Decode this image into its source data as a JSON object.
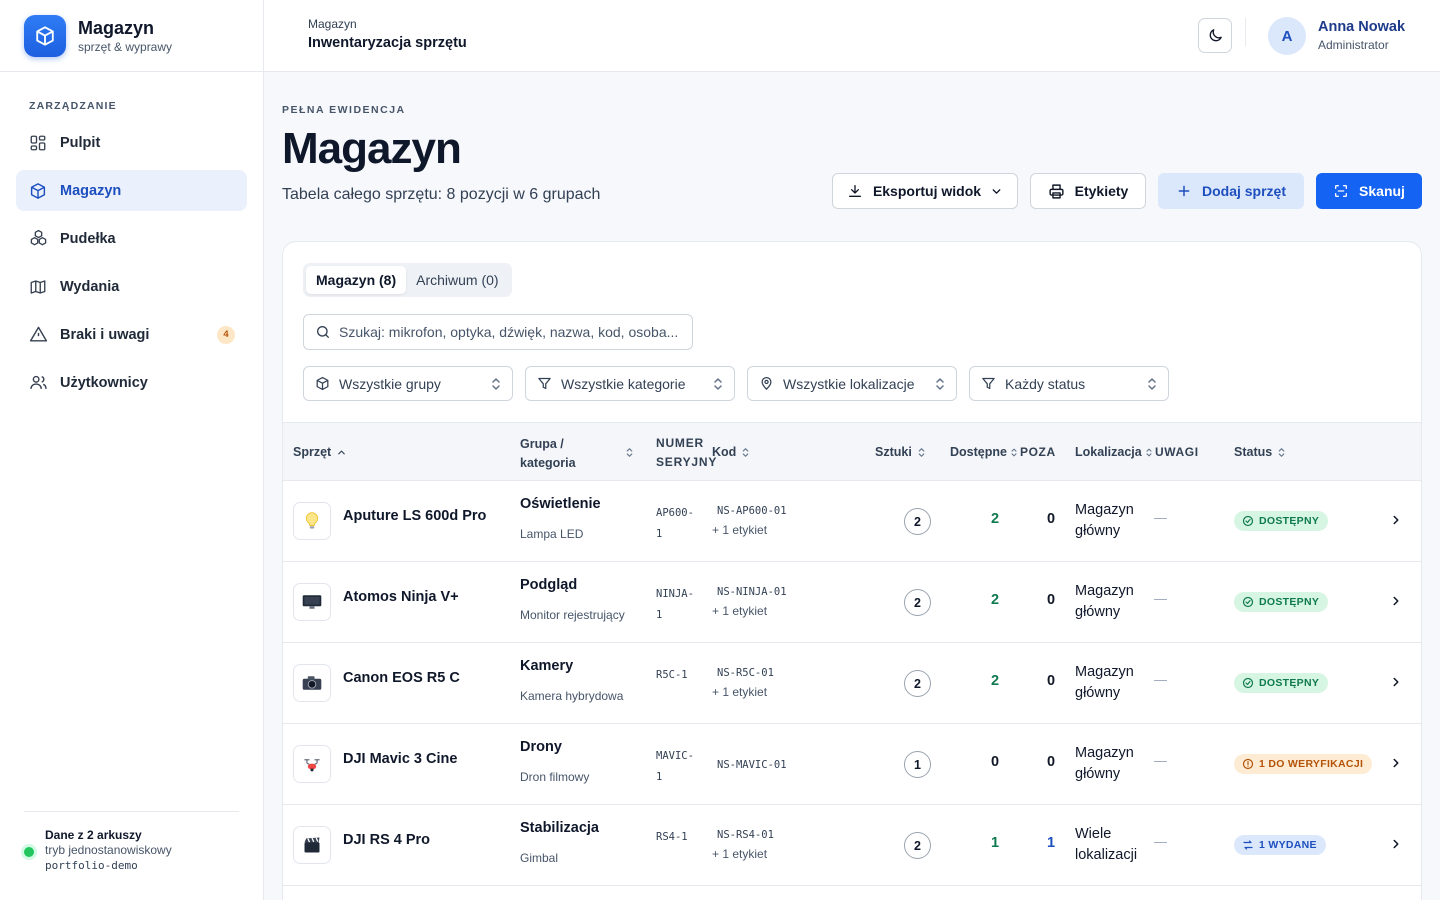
{
  "brand": {
    "title": "Magazyn",
    "subtitle": "sprzęt & wyprawy"
  },
  "sidebar": {
    "section_label": "ZARZĄDZANIE",
    "items": [
      {
        "label": "Pulpit",
        "icon": "dashboard-icon"
      },
      {
        "label": "Magazyn",
        "icon": "box-icon",
        "active": true
      },
      {
        "label": "Pudełka",
        "icon": "boxes-icon"
      },
      {
        "label": "Wydania",
        "icon": "map-icon"
      },
      {
        "label": "Braki i uwagi",
        "icon": "warning-icon",
        "badge": "4"
      },
      {
        "label": "Użytkownicy",
        "icon": "users-icon"
      }
    ],
    "footer": {
      "title": "Dane z 2 arkuszy",
      "subtitle": "tryb jednostanowiskowy",
      "workspace": "portfolio-demo"
    }
  },
  "topbar": {
    "breadcrumb_parent": "Magazyn",
    "breadcrumb_current": "Inwentaryzacja sprzętu",
    "user": {
      "initial": "A",
      "name": "Anna Nowak",
      "role": "Administrator"
    }
  },
  "header": {
    "eyebrow": "PEŁNA EWIDENCJA",
    "title": "Magazyn",
    "subtitle": "Tabela całego sprzętu: 8 pozycji w 6 grupach",
    "actions": {
      "export": "Eksportuj widok",
      "labels": "Etykiety",
      "add": "Dodaj sprzęt",
      "scan": "Skanuj"
    }
  },
  "tabs": [
    {
      "label": "Magazyn (8)",
      "active": true
    },
    {
      "label": "Archiwum (0)"
    }
  ],
  "search": {
    "placeholder": "Szukaj: mikrofon, optyka, dźwięk, nazwa, kod, osoba..."
  },
  "filters": {
    "groups": "Wszystkie grupy",
    "categories": "Wszystkie kategorie",
    "locations": "Wszystkie lokalizacje",
    "status": "Każdy status"
  },
  "table": {
    "columns": {
      "equipment": "Sprzęt",
      "group": "Grupa /",
      "group2": "kategoria",
      "serial": "NUMER",
      "serial2": "SERYJNY",
      "code": "Kod",
      "qty": "Sztuki",
      "available": "Dostępne",
      "out": "POZA",
      "location": "Lokalizacja",
      "notes": "UWAGI",
      "status": "Status"
    },
    "rows": [
      {
        "name": "Aputure LS 600d Pro",
        "icon": "bulb-icon",
        "group": "Oświetlenie",
        "category": "Lampa LED",
        "serial": "AP600-1",
        "code": "NS-AP600-01",
        "code_extra": "+ 1 etykiet",
        "qty": "2",
        "available": "2",
        "out": "0",
        "location": "Magazyn główny",
        "notes": "—",
        "status": "DOSTĘPNY",
        "status_kind": "ok"
      },
      {
        "name": "Atomos Ninja V+",
        "icon": "monitor-icon",
        "group": "Podgląd",
        "category": "Monitor rejestrujący",
        "serial": "NINJA-1",
        "code": "NS-NINJA-01",
        "code_extra": "+ 1 etykiet",
        "qty": "2",
        "available": "2",
        "out": "0",
        "location": "Magazyn główny",
        "notes": "—",
        "status": "DOSTĘPNY",
        "status_kind": "ok"
      },
      {
        "name": "Canon EOS R5 C",
        "icon": "camera-icon",
        "group": "Kamery",
        "category": "Kamera hybrydowa",
        "serial": "R5C-1",
        "code": "NS-R5C-01",
        "code_extra": "+ 1 etykiet",
        "qty": "2",
        "available": "2",
        "out": "0",
        "location": "Magazyn główny",
        "notes": "—",
        "status": "DOSTĘPNY",
        "status_kind": "ok"
      },
      {
        "name": "DJI Mavic 3 Cine",
        "icon": "drone-icon",
        "group": "Drony",
        "category": "Dron filmowy",
        "serial": "MAVIC-1",
        "code": "NS-MAVIC-01",
        "code_extra": "",
        "qty": "1",
        "available": "0",
        "out": "0",
        "location": "Magazyn główny",
        "notes": "—",
        "status": "1 DO WERYFIKACJI",
        "status_kind": "warn"
      },
      {
        "name": "DJI RS 4 Pro",
        "icon": "clapper-icon",
        "group": "Stabilizacja",
        "category": "Gimbal",
        "serial": "RS4-1",
        "code": "NS-RS4-01",
        "code_extra": "+ 1 etykiet",
        "qty": "2",
        "available": "1",
        "out": "1",
        "location": "Wiele lokalizacji",
        "notes": "—",
        "status": "1 WYDANE",
        "status_kind": "issued"
      }
    ]
  },
  "colors": {
    "accent": "#1463f3",
    "ok": "#0f7a4f",
    "warn": "#b45309",
    "issued": "#1d4fbf"
  }
}
